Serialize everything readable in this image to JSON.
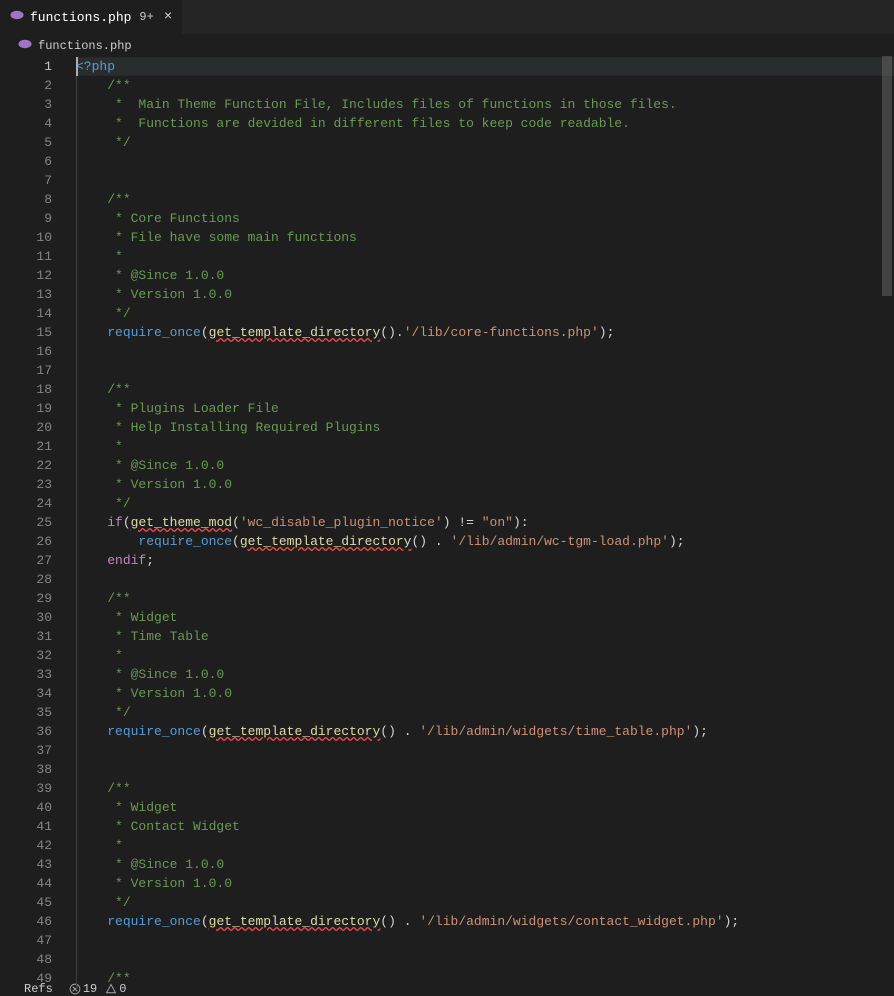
{
  "tab": {
    "filename": "functions.php",
    "dirty_badge": "9+",
    "close_glyph": "×"
  },
  "breadcrumb": {
    "filename": "functions.php"
  },
  "status": {
    "errors": "19",
    "warnings": "0",
    "refs_label": "Refs"
  },
  "code": {
    "lines": [
      {
        "n": 1,
        "indent": 0,
        "t": [
          {
            "c": "tok-phptag",
            "v": "<?php"
          }
        ]
      },
      {
        "n": 2,
        "indent": 1,
        "t": [
          {
            "c": "tok-comment",
            "v": "/**"
          }
        ]
      },
      {
        "n": 3,
        "indent": 1,
        "t": [
          {
            "c": "tok-comment",
            "v": " *  Main Theme Function File, Includes files of functions in those files."
          }
        ]
      },
      {
        "n": 4,
        "indent": 1,
        "t": [
          {
            "c": "tok-comment",
            "v": " *  Functions are devided in different files to keep code readable."
          }
        ]
      },
      {
        "n": 5,
        "indent": 1,
        "t": [
          {
            "c": "tok-comment",
            "v": " */"
          }
        ]
      },
      {
        "n": 6,
        "indent": 1,
        "t": []
      },
      {
        "n": 7,
        "indent": 1,
        "t": []
      },
      {
        "n": 8,
        "indent": 1,
        "t": [
          {
            "c": "tok-comment",
            "v": "/**"
          }
        ]
      },
      {
        "n": 9,
        "indent": 1,
        "t": [
          {
            "c": "tok-comment",
            "v": " * Core Functions"
          }
        ]
      },
      {
        "n": 10,
        "indent": 1,
        "t": [
          {
            "c": "tok-comment",
            "v": " * File have some main functions"
          }
        ]
      },
      {
        "n": 11,
        "indent": 1,
        "t": [
          {
            "c": "tok-comment",
            "v": " *"
          }
        ]
      },
      {
        "n": 12,
        "indent": 1,
        "t": [
          {
            "c": "tok-comment",
            "v": " * @Since 1.0.0"
          }
        ]
      },
      {
        "n": 13,
        "indent": 1,
        "t": [
          {
            "c": "tok-comment",
            "v": " * Version 1.0.0"
          }
        ]
      },
      {
        "n": 14,
        "indent": 1,
        "t": [
          {
            "c": "tok-comment",
            "v": " */"
          }
        ]
      },
      {
        "n": 15,
        "indent": 1,
        "t": [
          {
            "c": "tok-keyword2",
            "v": "require_once"
          },
          {
            "c": "tok-paren",
            "v": "("
          },
          {
            "c": "tok-func-warn",
            "v": "get_template_directory"
          },
          {
            "c": "tok-paren",
            "v": "()"
          },
          {
            "c": "tok-op",
            "v": "."
          },
          {
            "c": "tok-string",
            "v": "'/lib/core-functions.php'"
          },
          {
            "c": "tok-paren",
            "v": ")"
          },
          {
            "c": "tok-semicolon",
            "v": ";"
          }
        ]
      },
      {
        "n": 16,
        "indent": 0,
        "t": []
      },
      {
        "n": 17,
        "indent": 0,
        "t": []
      },
      {
        "n": 18,
        "indent": 1,
        "t": [
          {
            "c": "tok-comment",
            "v": "/**"
          }
        ]
      },
      {
        "n": 19,
        "indent": 1,
        "t": [
          {
            "c": "tok-comment",
            "v": " * Plugins Loader File"
          }
        ]
      },
      {
        "n": 20,
        "indent": 1,
        "t": [
          {
            "c": "tok-comment",
            "v": " * Help Installing Required Plugins"
          }
        ]
      },
      {
        "n": 21,
        "indent": 1,
        "t": [
          {
            "c": "tok-comment",
            "v": " *"
          }
        ]
      },
      {
        "n": 22,
        "indent": 1,
        "t": [
          {
            "c": "tok-comment",
            "v": " * @Since 1.0.0"
          }
        ]
      },
      {
        "n": 23,
        "indent": 1,
        "t": [
          {
            "c": "tok-comment",
            "v": " * Version 1.0.0"
          }
        ]
      },
      {
        "n": 24,
        "indent": 1,
        "t": [
          {
            "c": "tok-comment",
            "v": " */"
          }
        ]
      },
      {
        "n": 25,
        "indent": 1,
        "t": [
          {
            "c": "tok-keyword",
            "v": "if"
          },
          {
            "c": "tok-paren",
            "v": "("
          },
          {
            "c": "tok-func-warn",
            "v": "get_theme_mod"
          },
          {
            "c": "tok-paren",
            "v": "("
          },
          {
            "c": "tok-string",
            "v": "'wc_disable_plugin_notice'"
          },
          {
            "c": "tok-paren",
            "v": ")"
          },
          {
            "c": "tok-op",
            "v": " != "
          },
          {
            "c": "tok-string",
            "v": "\"on\""
          },
          {
            "c": "tok-paren",
            "v": ")"
          },
          {
            "c": "tok-colon",
            "v": ":"
          }
        ]
      },
      {
        "n": 26,
        "indent": 2,
        "t": [
          {
            "c": "tok-keyword2",
            "v": "require_once"
          },
          {
            "c": "tok-paren",
            "v": "("
          },
          {
            "c": "tok-func-warn",
            "v": "get_template_directory"
          },
          {
            "c": "tok-paren",
            "v": "()"
          },
          {
            "c": "tok-op",
            "v": " . "
          },
          {
            "c": "tok-string",
            "v": "'/lib/admin/wc-tgm-load.php'"
          },
          {
            "c": "tok-paren",
            "v": ")"
          },
          {
            "c": "tok-semicolon",
            "v": ";"
          }
        ]
      },
      {
        "n": 27,
        "indent": 1,
        "t": [
          {
            "c": "tok-keyword",
            "v": "endif"
          },
          {
            "c": "tok-semicolon",
            "v": ";"
          }
        ]
      },
      {
        "n": 28,
        "indent": 0,
        "t": []
      },
      {
        "n": 29,
        "indent": 1,
        "t": [
          {
            "c": "tok-comment",
            "v": "/**"
          }
        ]
      },
      {
        "n": 30,
        "indent": 1,
        "t": [
          {
            "c": "tok-comment",
            "v": " * Widget"
          }
        ]
      },
      {
        "n": 31,
        "indent": 1,
        "t": [
          {
            "c": "tok-comment",
            "v": " * Time Table"
          }
        ]
      },
      {
        "n": 32,
        "indent": 1,
        "t": [
          {
            "c": "tok-comment",
            "v": " *"
          }
        ]
      },
      {
        "n": 33,
        "indent": 1,
        "t": [
          {
            "c": "tok-comment",
            "v": " * @Since 1.0.0"
          }
        ]
      },
      {
        "n": 34,
        "indent": 1,
        "t": [
          {
            "c": "tok-comment",
            "v": " * Version 1.0.0"
          }
        ]
      },
      {
        "n": 35,
        "indent": 1,
        "t": [
          {
            "c": "tok-comment",
            "v": " */"
          }
        ]
      },
      {
        "n": 36,
        "indent": 1,
        "t": [
          {
            "c": "tok-keyword2",
            "v": "require_once"
          },
          {
            "c": "tok-paren",
            "v": "("
          },
          {
            "c": "tok-func-warn",
            "v": "get_template_directory"
          },
          {
            "c": "tok-paren",
            "v": "()"
          },
          {
            "c": "tok-op",
            "v": " . "
          },
          {
            "c": "tok-string",
            "v": "'/lib/admin/widgets/time_table.php'"
          },
          {
            "c": "tok-paren",
            "v": ")"
          },
          {
            "c": "tok-semicolon",
            "v": ";"
          }
        ]
      },
      {
        "n": 37,
        "indent": 0,
        "t": []
      },
      {
        "n": 38,
        "indent": 0,
        "t": []
      },
      {
        "n": 39,
        "indent": 1,
        "t": [
          {
            "c": "tok-comment",
            "v": "/**"
          }
        ]
      },
      {
        "n": 40,
        "indent": 1,
        "t": [
          {
            "c": "tok-comment",
            "v": " * Widget"
          }
        ]
      },
      {
        "n": 41,
        "indent": 1,
        "t": [
          {
            "c": "tok-comment",
            "v": " * Contact Widget"
          }
        ]
      },
      {
        "n": 42,
        "indent": 1,
        "t": [
          {
            "c": "tok-comment",
            "v": " *"
          }
        ]
      },
      {
        "n": 43,
        "indent": 1,
        "t": [
          {
            "c": "tok-comment",
            "v": " * @Since 1.0.0"
          }
        ]
      },
      {
        "n": 44,
        "indent": 1,
        "t": [
          {
            "c": "tok-comment",
            "v": " * Version 1.0.0"
          }
        ]
      },
      {
        "n": 45,
        "indent": 1,
        "t": [
          {
            "c": "tok-comment",
            "v": " */"
          }
        ]
      },
      {
        "n": 46,
        "indent": 1,
        "t": [
          {
            "c": "tok-keyword2",
            "v": "require_once"
          },
          {
            "c": "tok-paren",
            "v": "("
          },
          {
            "c": "tok-func-warn",
            "v": "get_template_directory"
          },
          {
            "c": "tok-paren",
            "v": "()"
          },
          {
            "c": "tok-op",
            "v": " . "
          },
          {
            "c": "tok-string",
            "v": "'/lib/admin/widgets/contact_widget.php'"
          },
          {
            "c": "tok-paren",
            "v": ")"
          },
          {
            "c": "tok-semicolon",
            "v": ";"
          }
        ]
      },
      {
        "n": 47,
        "indent": 0,
        "t": []
      },
      {
        "n": 48,
        "indent": 0,
        "t": []
      },
      {
        "n": 49,
        "indent": 1,
        "t": [
          {
            "c": "tok-comment",
            "v": "/**"
          }
        ]
      }
    ]
  }
}
